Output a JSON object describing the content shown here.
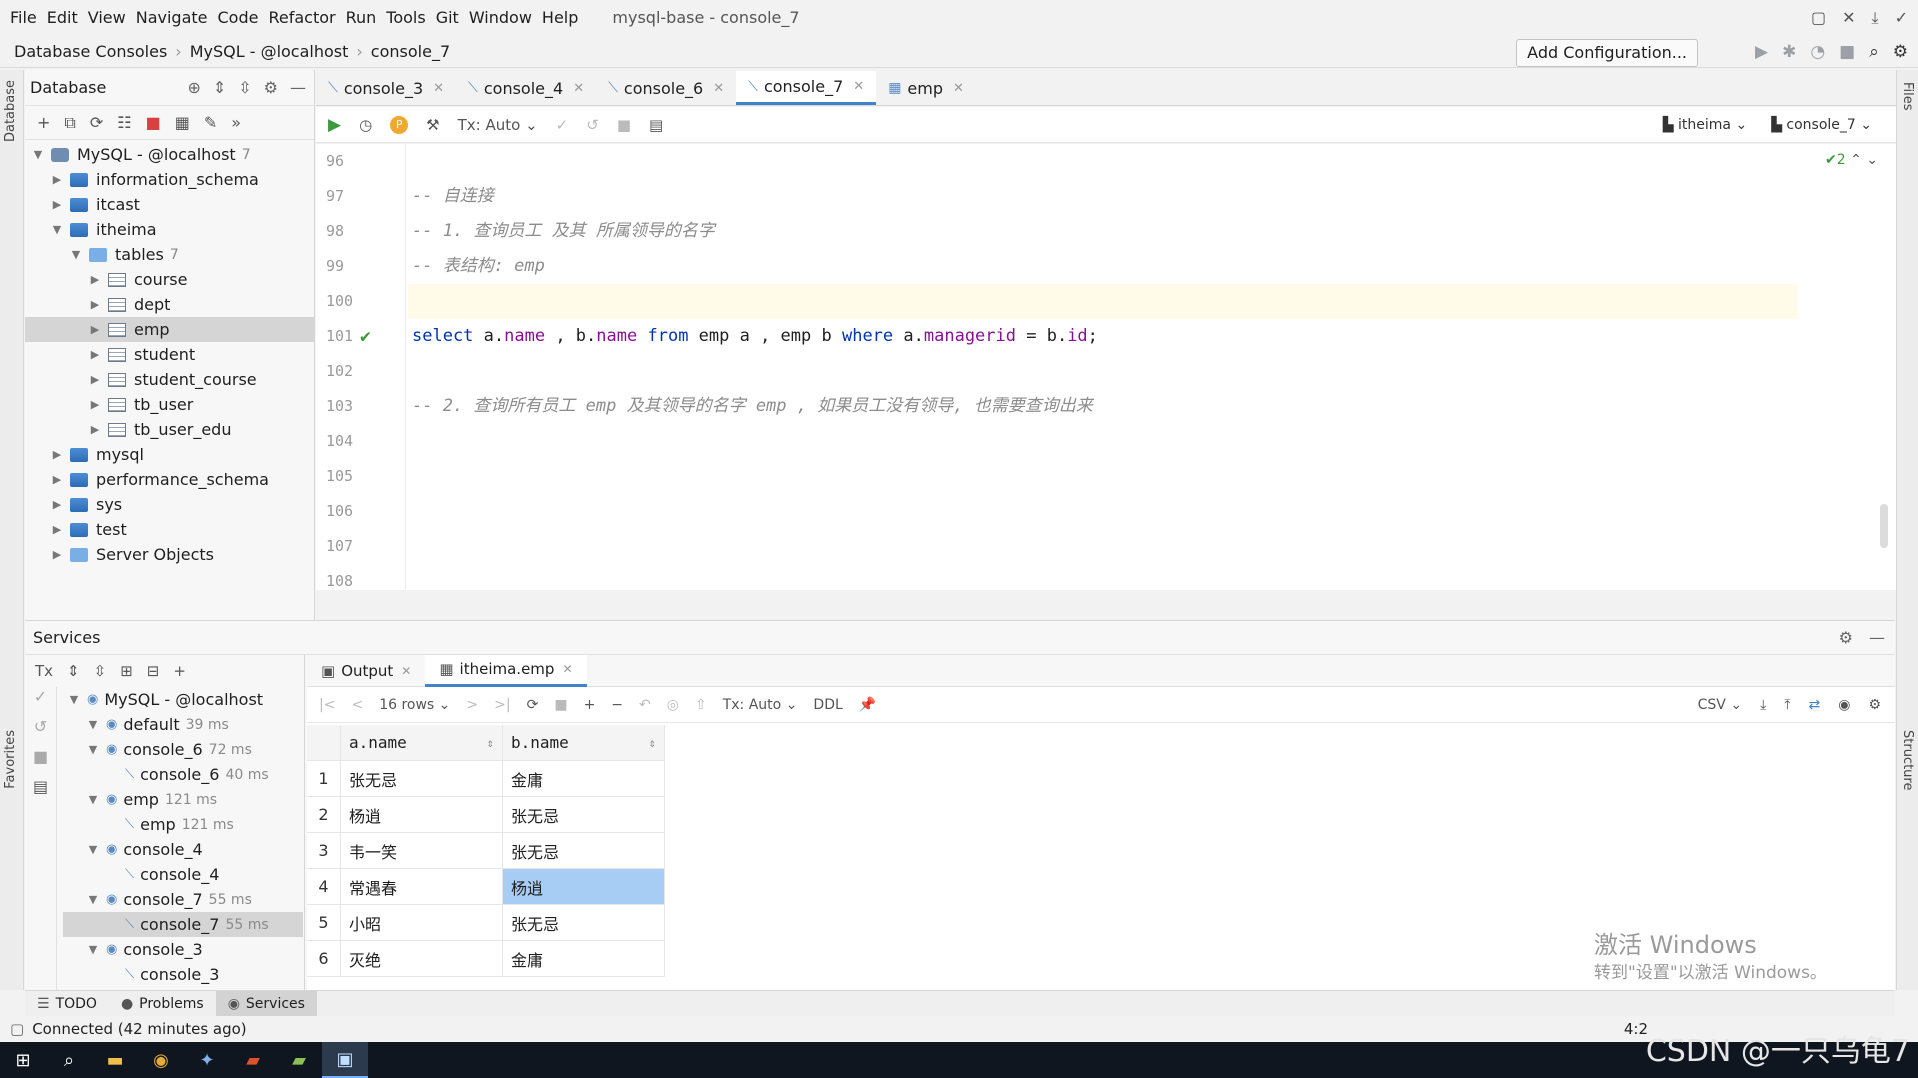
{
  "window": {
    "title": "mysql-base - console_7",
    "menu": [
      "File",
      "Edit",
      "View",
      "Navigate",
      "Code",
      "Refactor",
      "Run",
      "Tools",
      "Git",
      "Window",
      "Help"
    ]
  },
  "navbar": {
    "crumbs": [
      "Database Consoles",
      "MySQL - @localhost",
      "console_7"
    ],
    "add_configuration": "Add Configuration..."
  },
  "side_tabs": {
    "left_top": "Database",
    "left_bottom": "Favorites",
    "right_top": "Files",
    "right_bottom": "Structure"
  },
  "db_panel": {
    "title": "Database",
    "tree": [
      {
        "label": "MySQL - @localhost",
        "count": "7",
        "level": 0,
        "icon": "server",
        "expanded": true
      },
      {
        "label": "information_schema",
        "level": 1,
        "icon": "db"
      },
      {
        "label": "itcast",
        "level": 1,
        "icon": "db"
      },
      {
        "label": "itheima",
        "level": 1,
        "icon": "db",
        "expanded": true
      },
      {
        "label": "tables",
        "count": "7",
        "level": 2,
        "icon": "folder",
        "expanded": true
      },
      {
        "label": "course",
        "level": 3,
        "icon": "table"
      },
      {
        "label": "dept",
        "level": 3,
        "icon": "table"
      },
      {
        "label": "emp",
        "level": 3,
        "icon": "table",
        "selected": true
      },
      {
        "label": "student",
        "level": 3,
        "icon": "table"
      },
      {
        "label": "student_course",
        "level": 3,
        "icon": "table"
      },
      {
        "label": "tb_user",
        "level": 3,
        "icon": "table"
      },
      {
        "label": "tb_user_edu",
        "level": 3,
        "icon": "table"
      },
      {
        "label": "mysql",
        "level": 1,
        "icon": "db"
      },
      {
        "label": "performance_schema",
        "level": 1,
        "icon": "db"
      },
      {
        "label": "sys",
        "level": 1,
        "icon": "db"
      },
      {
        "label": "test",
        "level": 1,
        "icon": "db"
      },
      {
        "label": "Server Objects",
        "level": 1,
        "icon": "folder"
      }
    ]
  },
  "editor_tabs": [
    {
      "label": "console_3",
      "active": false
    },
    {
      "label": "console_4",
      "active": false
    },
    {
      "label": "console_6",
      "active": false
    },
    {
      "label": "console_7",
      "active": true
    },
    {
      "label": "emp",
      "active": false
    }
  ],
  "editor_toolbar": {
    "tx": "Tx: Auto",
    "schema": "itheima",
    "console": "console_7",
    "p": "P"
  },
  "editor": {
    "inspection": "✔2",
    "lines": [
      {
        "n": "96",
        "text": ""
      },
      {
        "n": "97",
        "text": "-- 自连接"
      },
      {
        "n": "98",
        "text": "-- 1. 查询员工 及其 所属领导的名字"
      },
      {
        "n": "99",
        "text": "-- 表结构: emp"
      },
      {
        "n": "100",
        "text": ""
      },
      {
        "n": "101",
        "text": "select a.name , b.name from emp a , emp b where a.managerid = b.id;"
      },
      {
        "n": "102",
        "text": ""
      },
      {
        "n": "103",
        "text": "-- 2. 查询所有员工 emp 及其领导的名字 emp , 如果员工没有领导, 也需要查询出来"
      },
      {
        "n": "104",
        "text": ""
      },
      {
        "n": "105",
        "text": ""
      },
      {
        "n": "106",
        "text": ""
      },
      {
        "n": "107",
        "text": ""
      },
      {
        "n": "108",
        "text": ""
      }
    ]
  },
  "services": {
    "title": "Services",
    "tree": [
      {
        "label": "MySQL - @localhost",
        "ms": "",
        "level": 0
      },
      {
        "label": "default",
        "ms": "39 ms",
        "level": 1
      },
      {
        "label": "console_6",
        "ms": "72 ms",
        "level": 1
      },
      {
        "label": "console_6",
        "ms": "40 ms",
        "level": 2
      },
      {
        "label": "emp",
        "ms": "121 ms",
        "level": 1
      },
      {
        "label": "emp",
        "ms": "121 ms",
        "level": 2
      },
      {
        "label": "console_4",
        "ms": "",
        "level": 1
      },
      {
        "label": "console_4",
        "ms": "",
        "level": 2
      },
      {
        "label": "console_7",
        "ms": "55 ms",
        "level": 1
      },
      {
        "label": "console_7",
        "ms": "55 ms",
        "level": 2,
        "selected": true
      },
      {
        "label": "console_3",
        "ms": "",
        "level": 1
      },
      {
        "label": "console_3",
        "ms": "",
        "level": 2
      }
    ],
    "result_tabs": [
      "Output",
      "itheima.emp"
    ],
    "result_toolbar": {
      "rows": "16 rows",
      "tx": "Tx: Auto",
      "ddl": "DDL",
      "format": "CSV"
    },
    "columns": [
      "a.name",
      "b.name"
    ],
    "rows": [
      [
        "1",
        "张无忌",
        "金庸"
      ],
      [
        "2",
        "杨逍",
        "张无忌"
      ],
      [
        "3",
        "韦一笑",
        "张无忌"
      ],
      [
        "4",
        "常遇春",
        "杨逍"
      ],
      [
        "5",
        "小昭",
        "张无忌"
      ],
      [
        "6",
        "灭绝",
        "金庸"
      ]
    ]
  },
  "watermark": {
    "line1": "激活 Windows",
    "line2": "转到\"设置\"以激活 Windows。"
  },
  "bottom_tabs": [
    "TODO",
    "Problems",
    "Services"
  ],
  "status": {
    "text": "Connected (42 minutes ago)",
    "position": "4:2"
  },
  "csdn": "CSDN @一只乌龟7"
}
